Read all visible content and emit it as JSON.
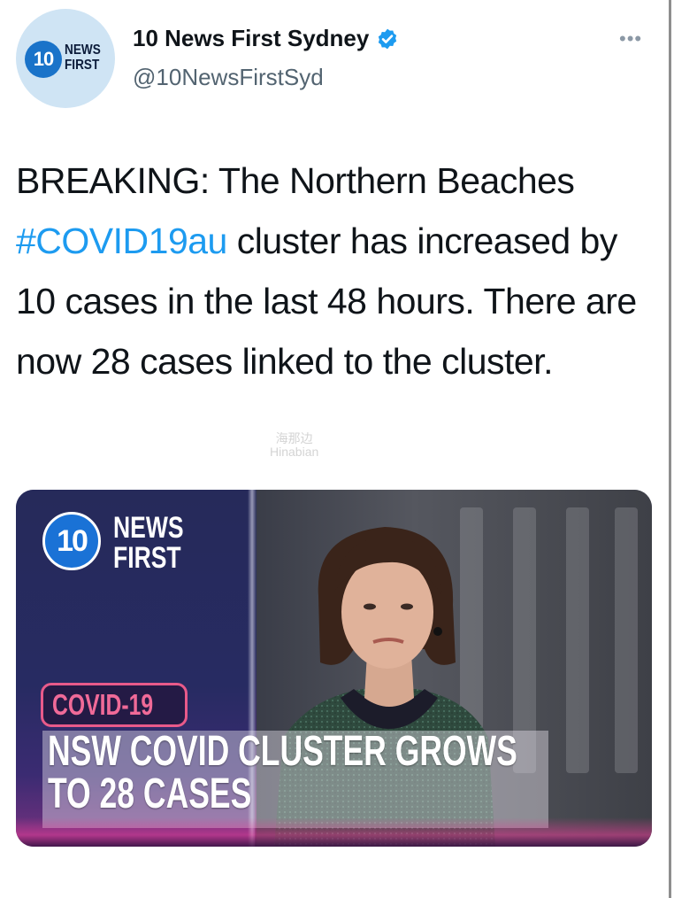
{
  "account": {
    "avatar_logo_number": "10",
    "avatar_logo_text": [
      "NEWS",
      "FIRST"
    ],
    "display_name": "10 News First Sydney",
    "handle": "@10NewsFirstSyd",
    "verified": true,
    "more_label": "•••"
  },
  "tweet": {
    "text_before_hashtag": "BREAKING: The Northern Beaches ",
    "hashtag": "#COVID19au",
    "text_after_hashtag": " cluster has increased by 10 cases in the last 48 hours. There are now 28 cases linked to the cluster."
  },
  "watermark": {
    "line1": "海那边",
    "line2": "Hinabian"
  },
  "media": {
    "logo_number": "10",
    "logo_line1": "NEWS",
    "logo_line2": "FIRST",
    "badge": "COVID-19",
    "headline_line1": "NSW COVID CLUSTER GROWS",
    "headline_line2": "TO 28 CASES"
  },
  "colors": {
    "hashtag": "#1d9bf0",
    "handle": "#536471",
    "verified_badge": "#1d9bf0",
    "badge_outline": "#e85a8a",
    "brand_blue": "#1a72d6"
  },
  "icons": {
    "verified": "verified-check-icon",
    "more": "more-horizontal-icon"
  }
}
